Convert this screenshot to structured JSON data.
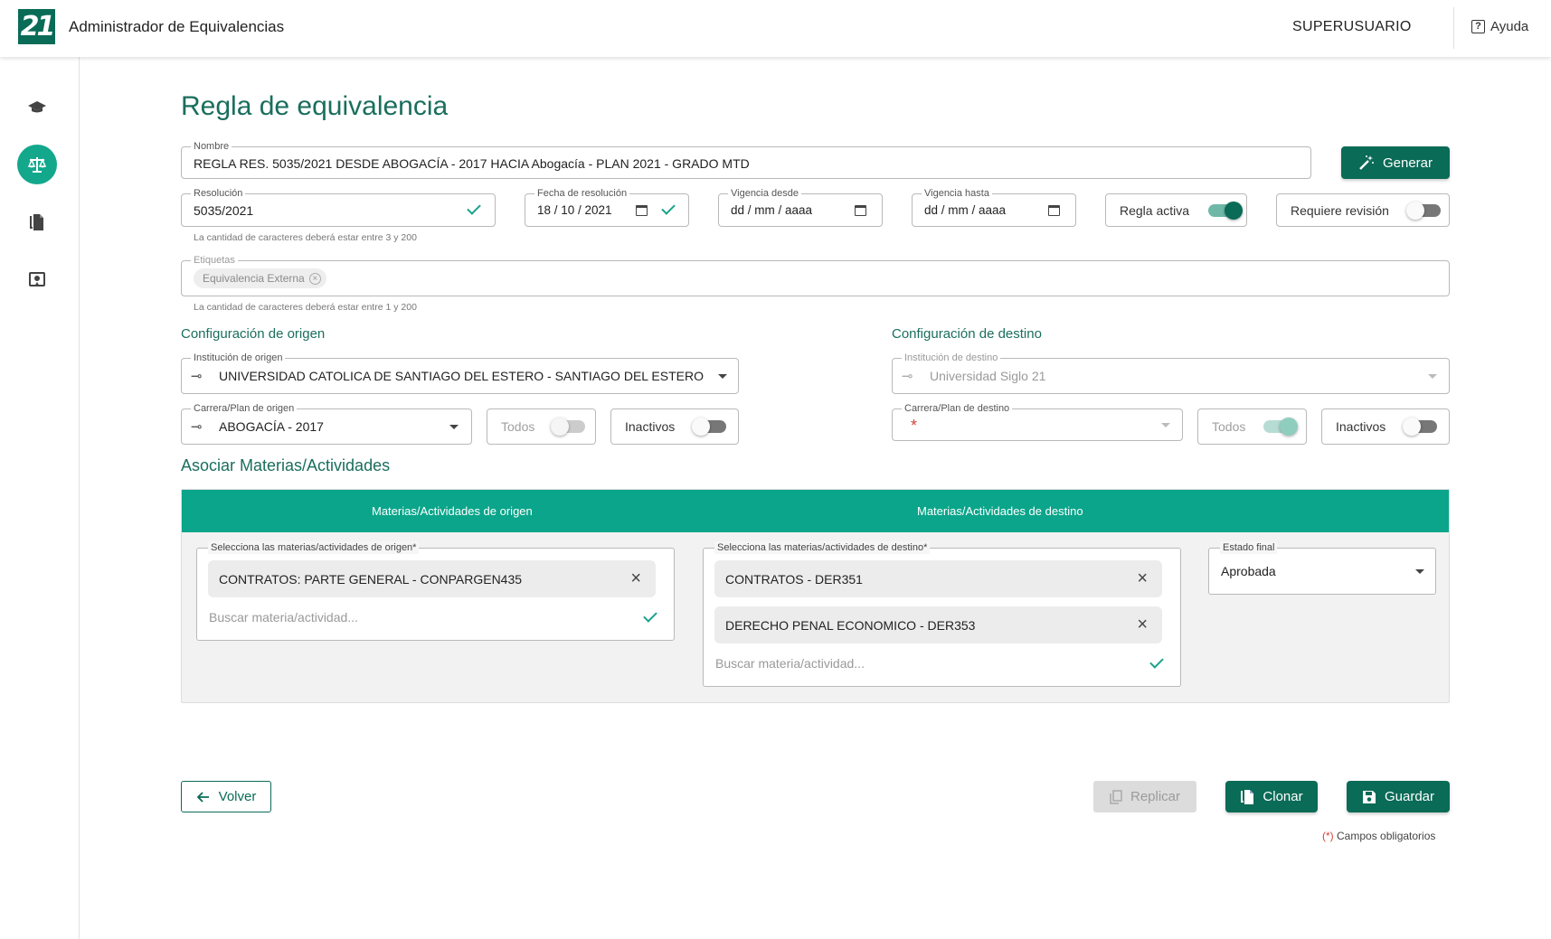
{
  "header": {
    "logo_text": "21",
    "app_title": "Administrador de Equivalencias",
    "user": "SUPERUSUARIO",
    "help": "Ayuda",
    "help_icon": "?"
  },
  "sidebar": {
    "items": [
      {
        "icon": "graduation-cap-icon",
        "active": false
      },
      {
        "icon": "balance-scale-icon",
        "active": true
      },
      {
        "icon": "copy-documents-icon",
        "active": false
      },
      {
        "icon": "certificate-icon",
        "active": false
      }
    ]
  },
  "page": {
    "title": "Regla de equivalencia"
  },
  "form": {
    "nombre": {
      "label": "Nombre",
      "value": "REGLA RES. 5035/2021 DESDE ABOGACÍA - 2017 HACIA Abogacía - PLAN 2021 - GRADO MTD"
    },
    "generar_label": "Generar",
    "resolucion": {
      "label": "Resolución",
      "value": "5035/2021",
      "hint": "La cantidad de caracteres deberá estar entre 3 y 200"
    },
    "fecha_resolucion": {
      "label": "Fecha de resolución",
      "value": "18 / 10 / 2021"
    },
    "vigencia_desde": {
      "label": "Vigencia desde",
      "value": "dd / mm / aaaa"
    },
    "vigencia_hasta": {
      "label": "Vigencia hasta",
      "value": "dd / mm / aaaa"
    },
    "regla_activa": {
      "label": "Regla activa",
      "on": true
    },
    "requiere_revision": {
      "label": "Requiere revisión",
      "on": false
    },
    "etiquetas": {
      "label": "Etiquetas",
      "chips": [
        "Equivalencia Externa"
      ],
      "hint": "La cantidad de caracteres deberá estar entre 1 y 200"
    }
  },
  "origen": {
    "section_title": "Configuración de origen",
    "institucion": {
      "label": "Institución de origen",
      "value": "UNIVERSIDAD CATOLICA DE SANTIAGO DEL ESTERO - SANTIAGO DEL ESTERO"
    },
    "carrera": {
      "label": "Carrera/Plan de origen",
      "value": "ABOGACÍA - 2017"
    },
    "todos": {
      "label": "Todos",
      "on": false,
      "disabled": true
    },
    "inactivos": {
      "label": "Inactivos",
      "on": false
    }
  },
  "destino": {
    "section_title": "Configuración de destino",
    "institucion": {
      "label": "Institución de destino",
      "value": "Universidad Siglo 21"
    },
    "carrera": {
      "label": "Carrera/Plan de destino",
      "value": "",
      "required_mark": "*"
    },
    "todos": {
      "label": "Todos",
      "on": true,
      "disabled": true
    },
    "inactivos": {
      "label": "Inactivos",
      "on": false
    }
  },
  "asociar": {
    "section_title": "Asociar Materias/Actividades",
    "tab_origen": "Materias/Actividades de origen",
    "tab_destino": "Materias/Actividades de destino",
    "origen_field": {
      "label": "Selecciona las materias/actividades de origen*",
      "items": [
        "CONTRATOS: PARTE GENERAL - CONPARGEN435"
      ],
      "placeholder": "Buscar materia/actividad..."
    },
    "destino_field": {
      "label": "Selecciona las materias/actividades de destino*",
      "items": [
        "CONTRATOS - DER351",
        "DERECHO PENAL ECONOMICO - DER353"
      ],
      "placeholder": "Buscar materia/actividad..."
    },
    "estado_final": {
      "label": "Estado final",
      "value": "Aprobada"
    }
  },
  "actions": {
    "volver": "Volver",
    "replicar": "Replicar",
    "clonar": "Clonar",
    "guardar": "Guardar",
    "required_note_mark": "(*)",
    "required_note": " Campos obligatorios"
  },
  "colors": {
    "primary": "#0a6b57",
    "accent": "#0aa58a",
    "sidebar_active": "#13a88c",
    "required": "#d0463b"
  }
}
